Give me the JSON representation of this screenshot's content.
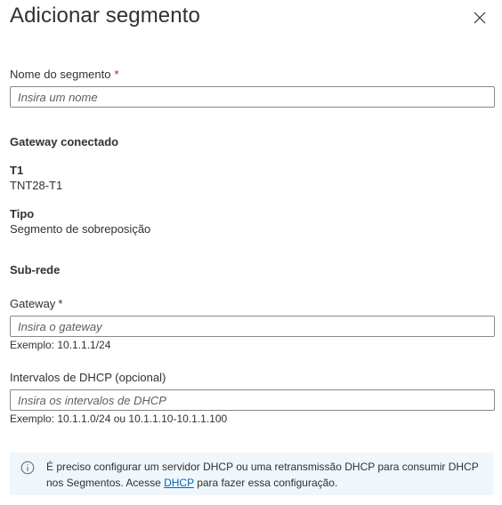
{
  "header": {
    "title": "Adicionar segmento",
    "close_icon": "close-icon"
  },
  "form": {
    "name": {
      "label": "Nome do segmento",
      "required_mark": "*",
      "placeholder": "Insira um nome",
      "value": ""
    },
    "gateway_section": {
      "heading": "Gateway conectado",
      "t1_label": "T1",
      "t1_value": "TNT28-T1",
      "type_label": "Tipo",
      "type_value": "Segmento de sobreposição"
    },
    "subnet_section": {
      "heading": "Sub-rede"
    },
    "gateway": {
      "label": "Gateway",
      "required_mark": "*",
      "placeholder": "Insira o gateway",
      "value": "",
      "hint": "Exemplo: 10.1.1.1/24"
    },
    "dhcp": {
      "label": "Intervalos de DHCP (opcional)",
      "placeholder": "Insira os intervalos de DHCP",
      "value": "",
      "hint": "Exemplo: 10.1.1.0/24 ou 10.1.1.10-10.1.1.100"
    }
  },
  "info": {
    "icon": "info-icon",
    "text_before": "É preciso configurar um servidor DHCP ou uma retransmissão DHCP para consumir DHCP nos Segmentos. Acesse ",
    "link": "DHCP",
    "text_after": " para fazer essa configuração.",
    "colors": {
      "background": "#eff6fc",
      "link": "#0067b8",
      "icon": "#605e5c"
    }
  }
}
